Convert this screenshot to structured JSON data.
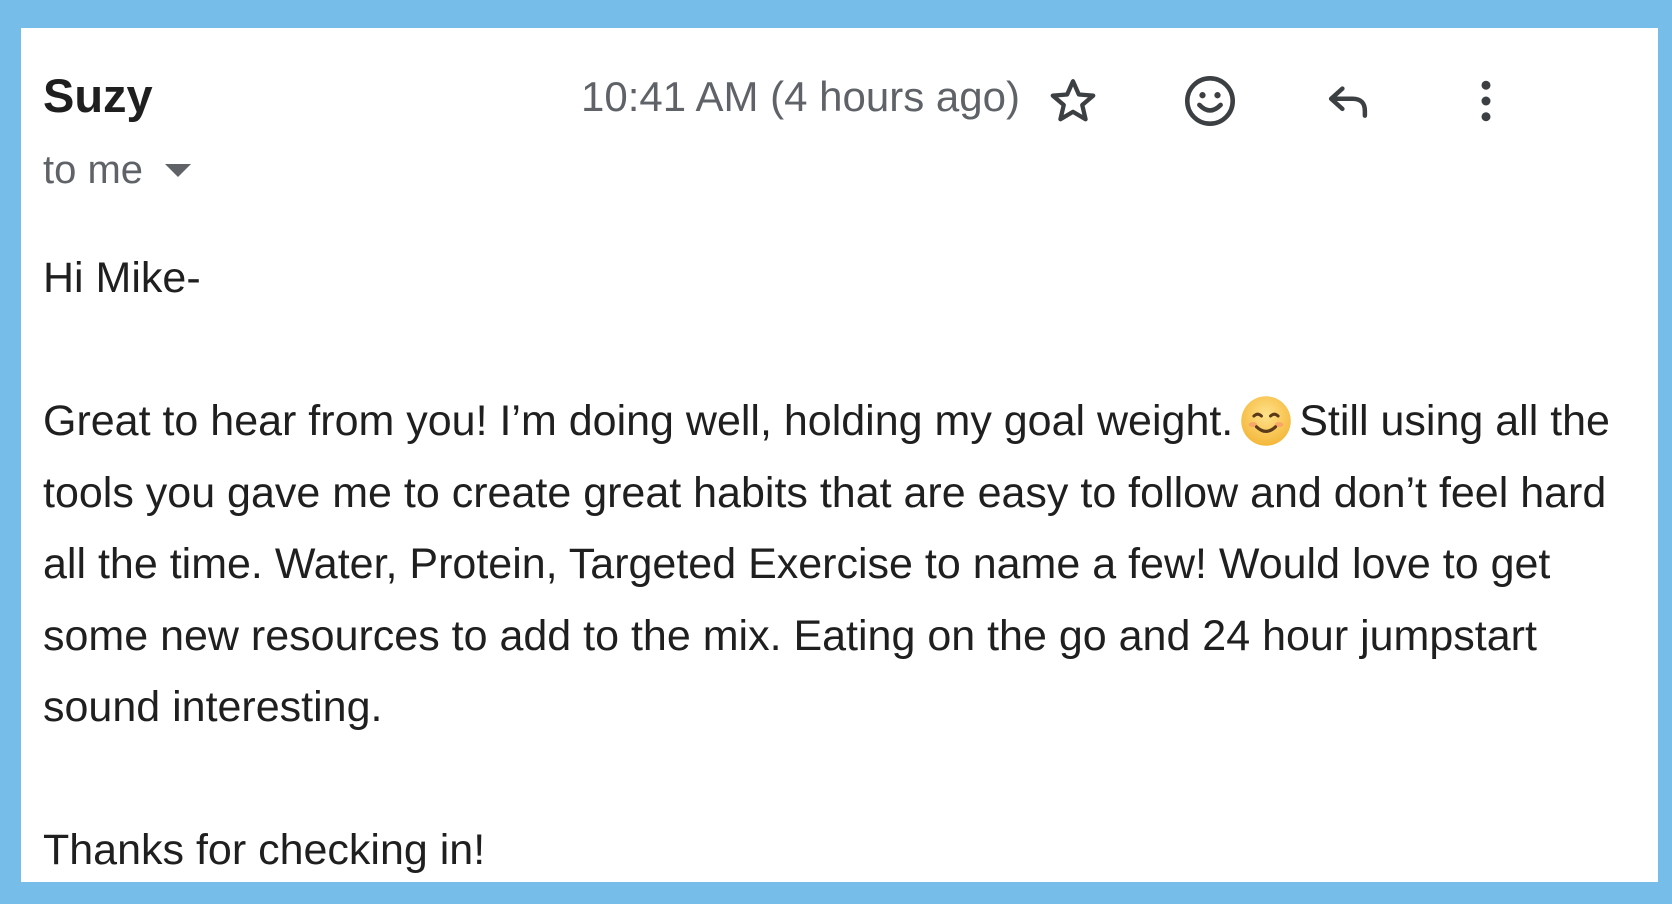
{
  "email": {
    "sender_name": "Suzy",
    "recipient_label": "to me",
    "timestamp": "10:41 AM (4 hours ago)",
    "actions": {
      "star_icon": "star-icon",
      "emoji_icon": "emoji-reaction-icon",
      "reply_icon": "reply-icon",
      "more_icon": "more-vert-icon"
    },
    "body": {
      "greeting": "Hi Mike-",
      "paragraph_before_emoji": "Great to hear from you!  I’m doing well, holding my goal weight.",
      "emoji_icon": "smiling-face-emoji",
      "paragraph_after_emoji": "Still using all the tools you gave me to create great habits that are easy to follow and don’t feel hard all the time.  Water, Protein, Targeted Exercise to name a few!  Would love to get some new resources to add to the mix.  Eating on the go and 24 hour jumpstart sound interesting.",
      "closing": "Thanks for checking in!"
    }
  },
  "colors": {
    "frame_background": "#77bdea",
    "card_background": "#ffffff",
    "primary_text": "#1f1f1f",
    "secondary_text": "#5f6368",
    "emoji_yellow": "#f7c544"
  }
}
